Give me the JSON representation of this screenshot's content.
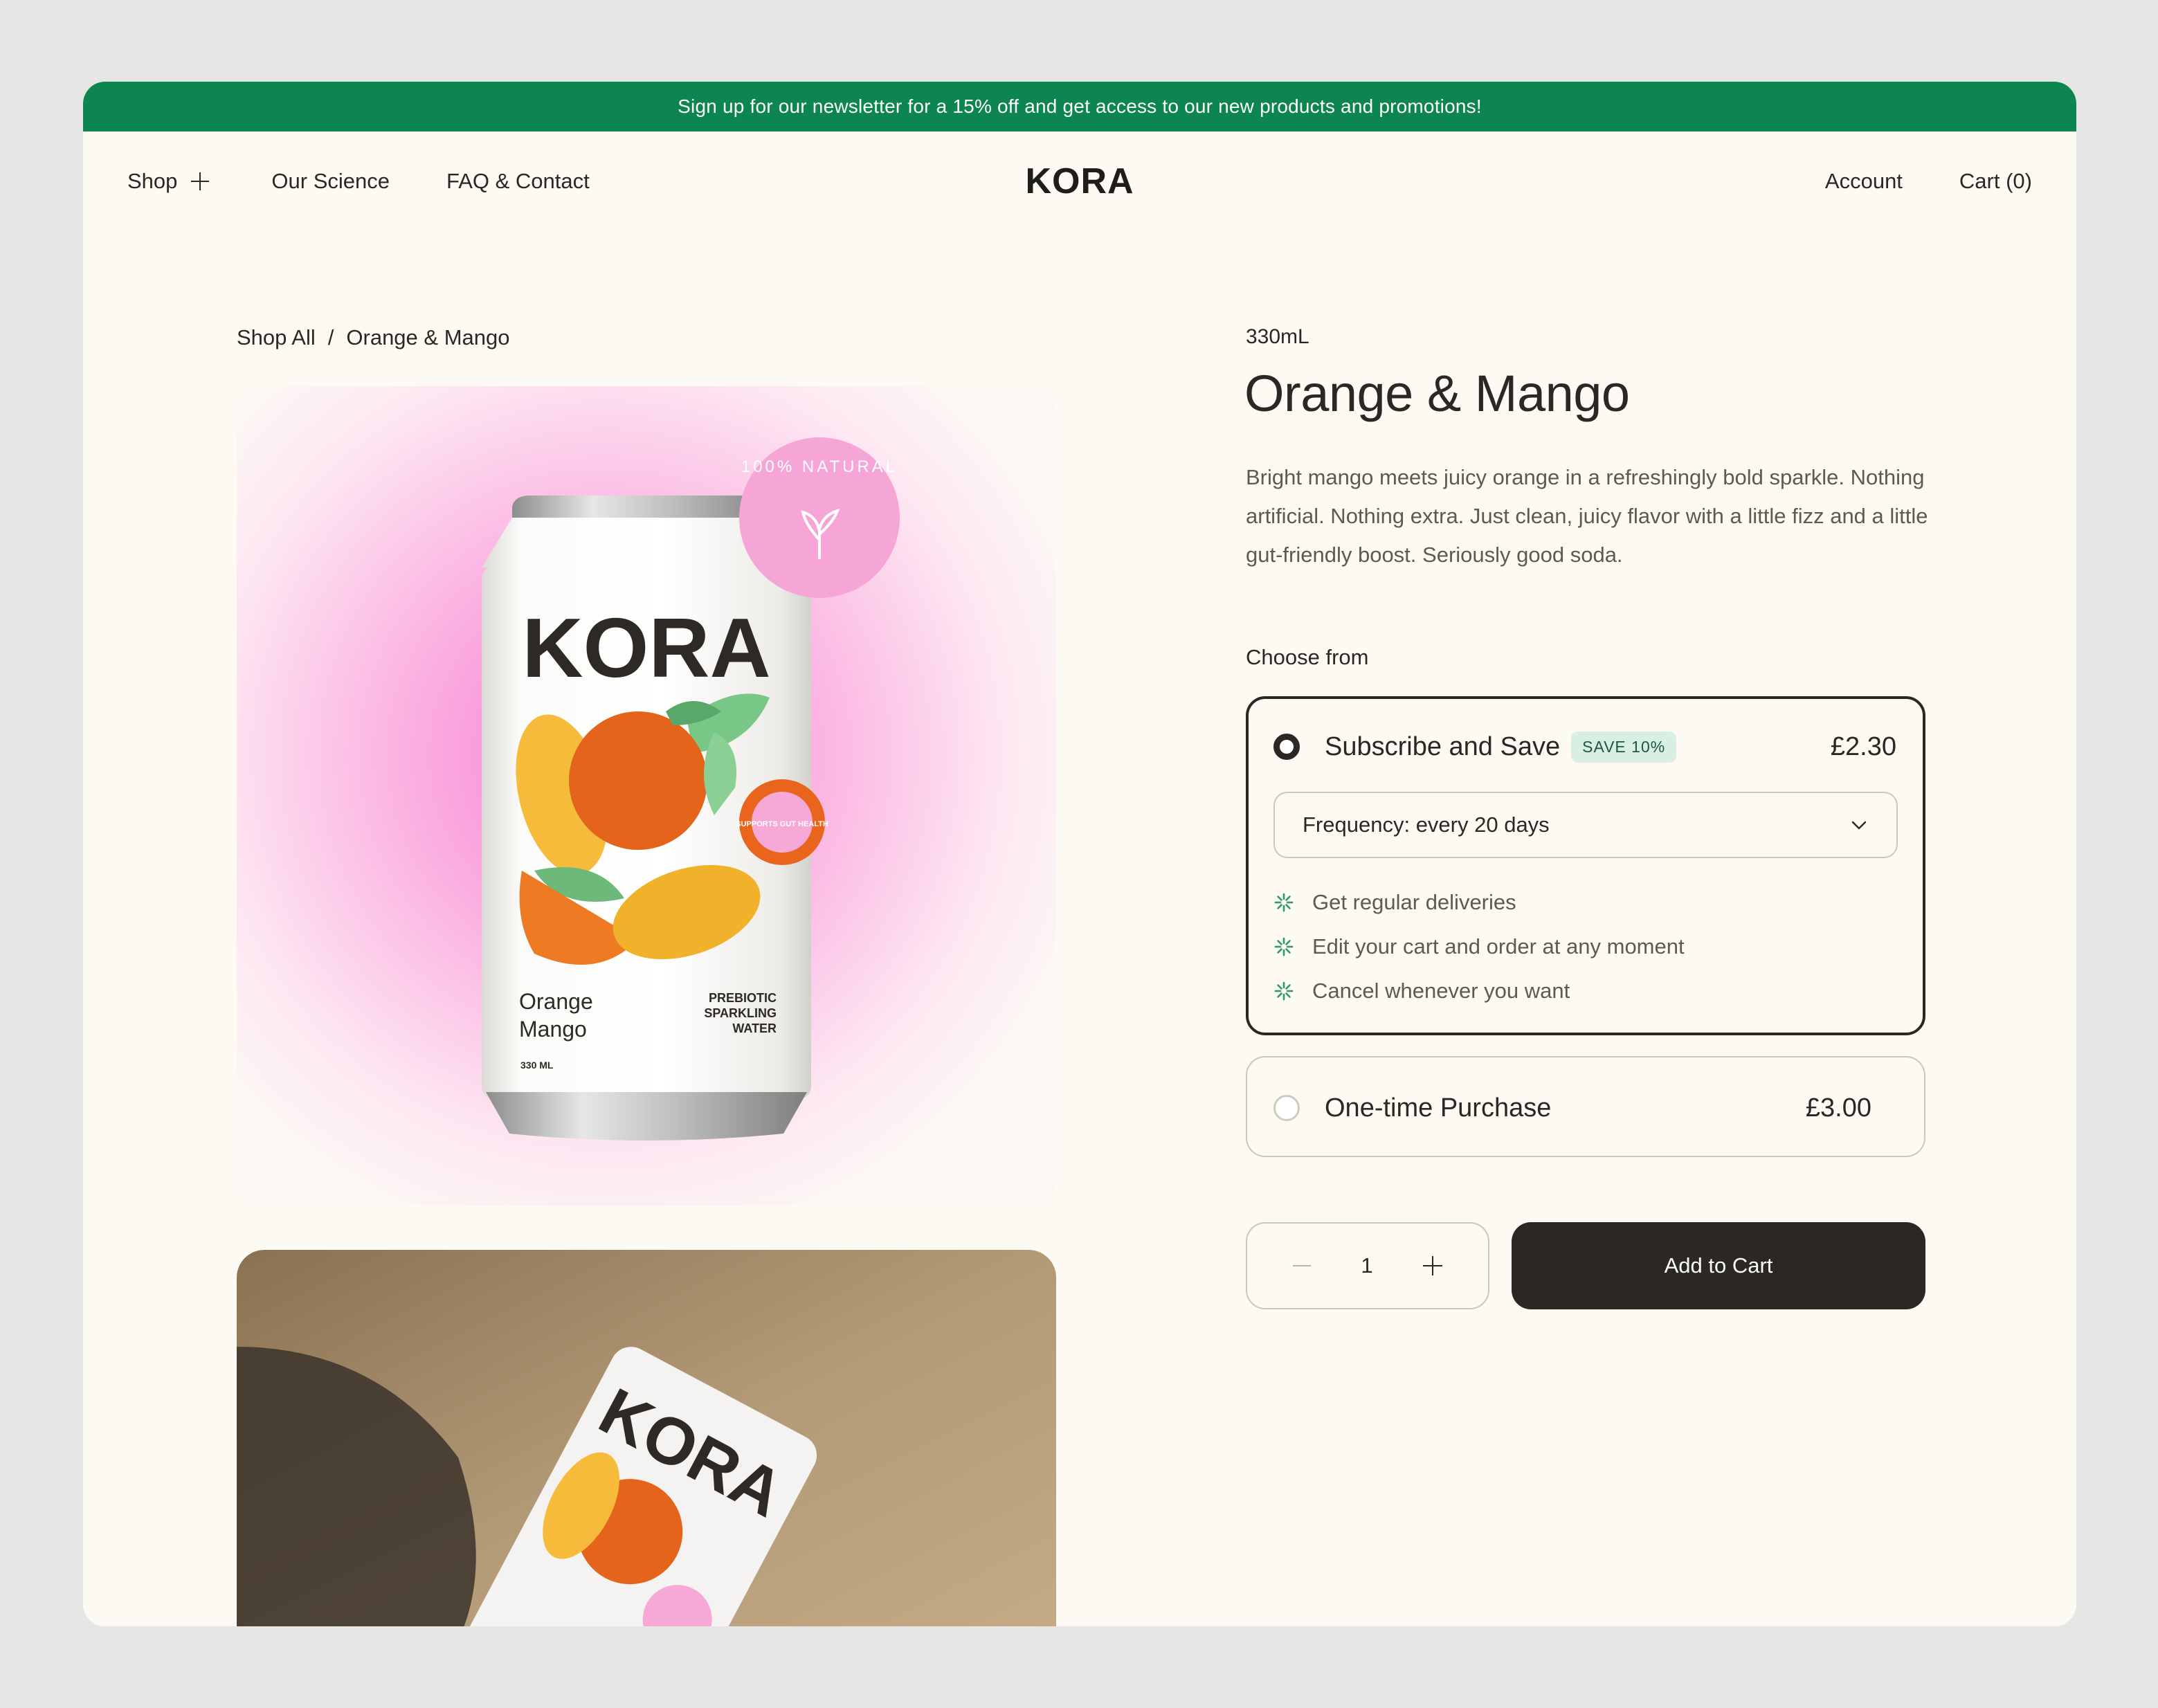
{
  "banner": {
    "text": "Sign up for our newsletter for a 15% off and get access to our new products and promotions!"
  },
  "nav": {
    "shop": "Shop",
    "science": "Our Science",
    "faq": "FAQ & Contact",
    "logo": "KORA",
    "account": "Account",
    "cart": "Cart (0)"
  },
  "breadcrumb": {
    "shop_all": "Shop All",
    "separator": "/",
    "current": "Orange & Mango"
  },
  "product": {
    "volume": "330mL",
    "title": "Orange & Mango",
    "description": "Bright mango meets juicy orange in a refreshingly bold sparkle. Nothing artificial. Nothing extra. Just clean, juicy flavor with a little fizz and a little gut-friendly boost. Seriously good soda."
  },
  "can": {
    "brand": "KORA",
    "flavor_line1": "Orange",
    "flavor_line2": "Mango",
    "type_line1": "PREBIOTIC",
    "type_line2": "SPARKLING",
    "type_line3": "WATER",
    "size": "330 ML",
    "sticker": "SUPPORTS GUT HEALTH",
    "seal": "100% NATURAL"
  },
  "options": {
    "heading": "Choose from",
    "subscribe": {
      "label": "Subscribe and Save",
      "badge": "SAVE 10%",
      "price": "£2.30",
      "frequency": "Frequency: every 20 days",
      "benefits": [
        "Get regular deliveries",
        "Edit your cart and order at any moment",
        "Cancel whenever you want"
      ]
    },
    "one_time": {
      "label": "One-time Purchase",
      "price": "£3.00"
    }
  },
  "cart": {
    "quantity": "1",
    "add_label": "Add to Cart"
  },
  "colors": {
    "banner": "#0d8550",
    "accent_pink": "#f7a6d6",
    "button_dark": "#2b2823",
    "badge_bg": "#d9efe1",
    "benefit_icon": "#2f9a62"
  }
}
